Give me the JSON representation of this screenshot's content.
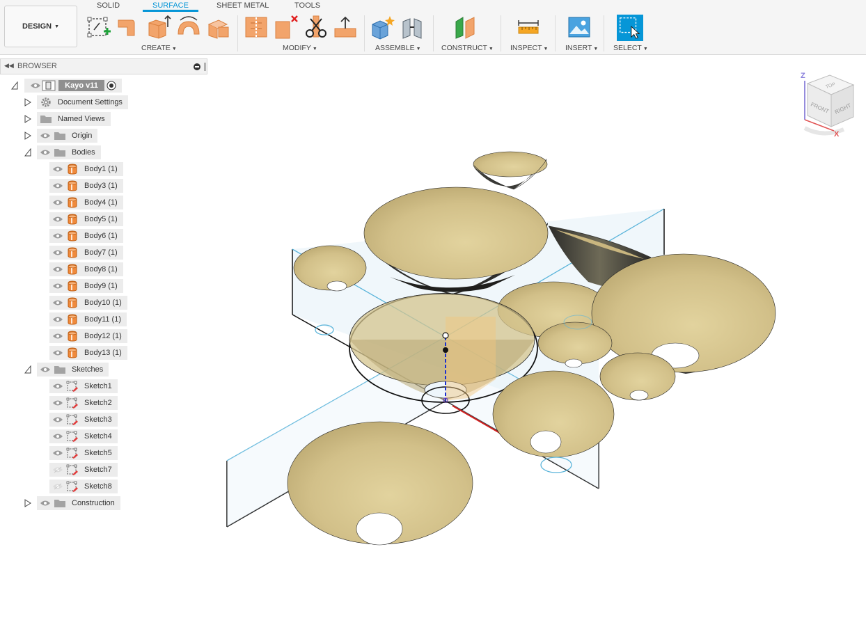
{
  "toolbar": {
    "workspace": "DESIGN",
    "tabs": [
      "SOLID",
      "SURFACE",
      "SHEET METAL",
      "TOOLS"
    ],
    "groups": {
      "create": "CREATE",
      "modify": "MODIFY",
      "assemble": "ASSEMBLE",
      "construct": "CONSTRUCT",
      "inspect": "INSPECT",
      "insert": "INSERT",
      "select": "SELECT"
    }
  },
  "browser": {
    "title": "BROWSER",
    "root": "Kayo v11",
    "items": {
      "document_settings": "Document Settings",
      "named_views": "Named Views",
      "origin": "Origin",
      "bodies": "Bodies",
      "sketches": "Sketches",
      "construction": "Construction"
    },
    "bodies": [
      "Body1 (1)",
      "Body3 (1)",
      "Body4 (1)",
      "Body5 (1)",
      "Body6 (1)",
      "Body7 (1)",
      "Body8 (1)",
      "Body9 (1)",
      "Body10 (1)",
      "Body11 (1)",
      "Body12 (1)",
      "Body13 (1)"
    ],
    "sketches": [
      "Sketch1",
      "Sketch2",
      "Sketch3",
      "Sketch4",
      "Sketch5",
      "Sketch7",
      "Sketch8"
    ]
  },
  "viewcube": {
    "faces": {
      "top": "TOP",
      "front": "FRONT",
      "right": "RIGHT"
    },
    "axes": {
      "z": "Z",
      "x": "X"
    }
  },
  "colors": {
    "accent": "#0696d7",
    "surface": "#d7c68f",
    "surface_shadow": "#3e3e3a",
    "plane_edge": "#5ab4da",
    "plane_fill": "#dfeff8",
    "body_icon": "#f08a3c"
  }
}
